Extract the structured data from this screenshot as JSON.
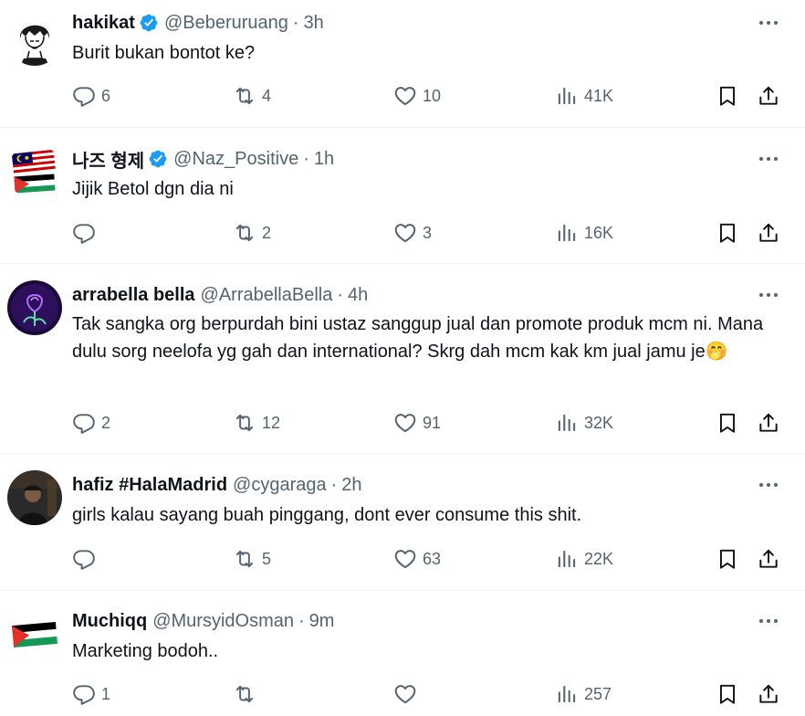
{
  "tweets": [
    {
      "name": "hakikat",
      "verified": true,
      "handle": "@Beberuruang",
      "time": "3h",
      "text": "Burit bukan bontot ke?",
      "replies": "6",
      "retweets": "4",
      "likes": "10",
      "views": "41K",
      "avatar": "line-art-portrait"
    },
    {
      "name": "나즈 형제",
      "verified": true,
      "handle": "@Naz_Positive",
      "time": "1h",
      "text": "Jijik Betol dgn dia ni",
      "replies": "",
      "retweets": "2",
      "likes": "3",
      "views": "16K",
      "avatar": "malaysia-palestine-flags"
    },
    {
      "name": "arrabella bella",
      "verified": false,
      "handle": "@ArrabellaBella",
      "time": "4h",
      "text": "Tak sangka org berpurdah bini ustaz sanggup jual dan promote produk mcm ni. Mana dulu sorg neelofa yg gah dan international? Skrg dah mcm kak km jual jamu je🤭",
      "replies": "2",
      "retweets": "12",
      "likes": "91",
      "views": "32K",
      "avatar": "neon-rose"
    },
    {
      "name": "hafiz #HalaMadrid",
      "verified": false,
      "handle": "@cygaraga",
      "time": "2h",
      "text": "girls kalau sayang buah pinggang, dont ever consume this shit.",
      "replies": "",
      "retweets": "5",
      "likes": "63",
      "views": "22K",
      "avatar": "dark-photo"
    },
    {
      "name": "Muchiqq",
      "verified": false,
      "handle": "@MursyidOsman",
      "time": "9m",
      "text": "Marketing bodoh..",
      "replies": "1",
      "retweets": "",
      "likes": "",
      "views": "257",
      "avatar": "palestine-flag"
    }
  ],
  "separator": "·",
  "colors": {
    "text": "#0f1419",
    "secondary": "#536471",
    "verified": "#1d9bf0",
    "border": "#eff3f4"
  },
  "icons": [
    "reply-icon",
    "retweet-icon",
    "like-icon",
    "views-icon",
    "bookmark-icon",
    "share-icon",
    "more-icon",
    "verified-badge-icon"
  ]
}
